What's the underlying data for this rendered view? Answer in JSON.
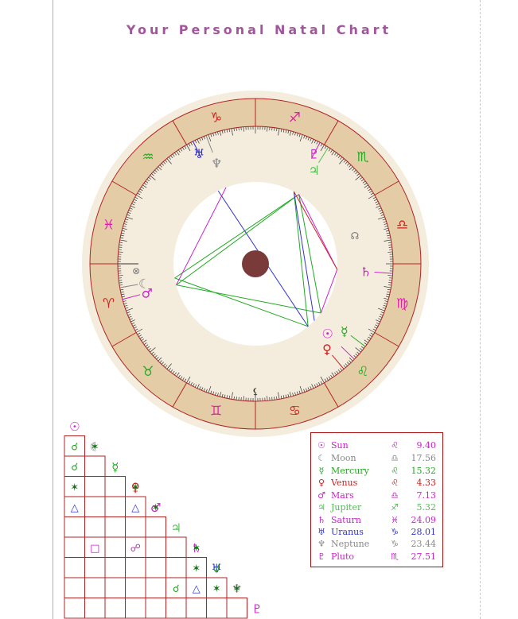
{
  "title": "Your Personal Natal Chart",
  "colors": {
    "frame": "#b22222",
    "cream": "#f4ecdc",
    "tan": "#e4cda6",
    "title": "#a0569a",
    "grey": "#888888"
  },
  "zodiac": [
    {
      "name": "capricorn-sign-icon",
      "glyph": "♑",
      "color": "#cc2222"
    },
    {
      "name": "sagittarius-sign-icon",
      "glyph": "♐",
      "color": "#dd22aa"
    },
    {
      "name": "scorpio-sign-icon",
      "glyph": "♏",
      "color": "#22aa22"
    },
    {
      "name": "libra-sign-icon",
      "glyph": "♎",
      "color": "#cc2222"
    },
    {
      "name": "virgo-sign-icon",
      "glyph": "♍",
      "color": "#dd22aa"
    },
    {
      "name": "leo-sign-icon",
      "glyph": "♌",
      "color": "#22aa22"
    },
    {
      "name": "cancer-sign-icon",
      "glyph": "♋",
      "color": "#cc2222"
    },
    {
      "name": "gemini-sign-icon",
      "glyph": "♊",
      "color": "#dd22aa"
    },
    {
      "name": "taurus-sign-icon",
      "glyph": "♉",
      "color": "#22aa22"
    },
    {
      "name": "aries-sign-icon",
      "glyph": "♈",
      "color": "#cc2222"
    },
    {
      "name": "pisces-sign-icon",
      "glyph": "♓",
      "color": "#dd22aa"
    },
    {
      "name": "aquarius-sign-icon",
      "glyph": "♒",
      "color": "#22aa22"
    }
  ],
  "planets": [
    {
      "name": "Sun",
      "glyph": "☉",
      "sign": "♌",
      "degree": "9.40",
      "color": "#cc22cc",
      "pos": 279.4
    },
    {
      "name": "Moon",
      "glyph": "☾",
      "sign": "♎",
      "degree": "17.56",
      "color": "#888888",
      "pos": 197.56
    },
    {
      "name": "Mercury",
      "glyph": "☿",
      "sign": "♌",
      "degree": "15.32",
      "color": "#22aa22",
      "pos": 285.32
    },
    {
      "name": "Venus",
      "glyph": "♀",
      "sign": "♌",
      "degree": "4.33",
      "color": "#cc2222",
      "pos": 274.33
    },
    {
      "name": "Mars",
      "glyph": "♂",
      "sign": "♎",
      "degree": "7.13",
      "color": "#cc22cc",
      "pos": 187.13
    },
    {
      "name": "Jupiter",
      "glyph": "♃",
      "sign": "♐",
      "degree": "5.32",
      "color": "#55bb55",
      "pos": 125.32
    },
    {
      "name": "Saturn",
      "glyph": "♄",
      "sign": "♓",
      "degree": "24.09",
      "color": "#cc22cc",
      "pos": 5.91
    },
    {
      "name": "Uranus",
      "glyph": "♅",
      "sign": "♑",
      "degree": "28.01",
      "color": "#3333cc",
      "pos": 61.99
    },
    {
      "name": "Neptune",
      "glyph": "♆",
      "sign": "♑",
      "degree": "23.44",
      "color": "#888888",
      "pos": 66.56
    },
    {
      "name": "Pluto",
      "glyph": "♇",
      "sign": "♏",
      "degree": "27.51",
      "color": "#cc22cc",
      "pos": 122.49
    }
  ],
  "extra_points": [
    {
      "name": "node-icon",
      "glyph": "☊",
      "color": "#777777",
      "pos": 164
    },
    {
      "name": "part-of-fortune-icon",
      "glyph": "⊗",
      "color": "#777777",
      "pos": 357
    },
    {
      "name": "lilith-icon",
      "glyph": "⚸",
      "color": "#333333",
      "pos": 268
    }
  ],
  "aspects": [
    {
      "a": 4,
      "b": 2,
      "type": "trine",
      "color": "#22aa22"
    },
    {
      "a": 4,
      "b": 5,
      "type": "trine",
      "color": "#22aa22"
    },
    {
      "a": 2,
      "b": 5,
      "type": "trine",
      "color": "#22aa22"
    },
    {
      "a": 1,
      "b": 3,
      "type": "sextile",
      "color": "#22aa22"
    },
    {
      "a": 1,
      "b": 5,
      "type": "sextile",
      "color": "#22aa22"
    },
    {
      "a": 3,
      "b": 9,
      "type": "sextile",
      "color": "#22aa22"
    },
    {
      "a": 0,
      "b": 9,
      "type": "square",
      "color": "#3333cc"
    },
    {
      "a": 3,
      "b": 7,
      "type": "opposition",
      "color": "#3333cc"
    },
    {
      "a": 6,
      "b": 5,
      "type": "square",
      "color": "#cc22cc"
    },
    {
      "a": 6,
      "b": 2,
      "type": "opposition",
      "color": "#cc22cc"
    },
    {
      "a": 4,
      "b": 8,
      "type": "opposition",
      "color": "#cc22cc"
    },
    {
      "a": 9,
      "b": 6,
      "type": "trine",
      "color": "#cc2222"
    }
  ],
  "grid_aspects": [
    {
      "row": 1,
      "col": 0,
      "glyph": "☌",
      "color": "#22aa22"
    },
    {
      "row": 1,
      "col": 1,
      "glyph": "✶",
      "color": "#117711"
    },
    {
      "row": 2,
      "col": 0,
      "glyph": "☌",
      "color": "#22aa22"
    },
    {
      "row": 3,
      "col": 0,
      "glyph": "✶",
      "color": "#117711"
    },
    {
      "row": 3,
      "col": 3,
      "glyph": "✶",
      "color": "#117711"
    },
    {
      "row": 4,
      "col": 0,
      "glyph": "△",
      "color": "#3333cc"
    },
    {
      "row": 4,
      "col": 3,
      "glyph": "△",
      "color": "#3333cc"
    },
    {
      "row": 4,
      "col": 4,
      "glyph": "✶",
      "color": "#117711"
    },
    {
      "row": 6,
      "col": 1,
      "glyph": "□",
      "color": "#cc22cc"
    },
    {
      "row": 6,
      "col": 3,
      "glyph": "☍",
      "color": "#cc22cc"
    },
    {
      "row": 6,
      "col": 6,
      "glyph": "✶",
      "color": "#117711"
    },
    {
      "row": 7,
      "col": 6,
      "glyph": "✶",
      "color": "#117711"
    },
    {
      "row": 7,
      "col": 7,
      "glyph": "☌",
      "color": "#22aa22"
    },
    {
      "row": 8,
      "col": 5,
      "glyph": "☌",
      "color": "#22aa22"
    },
    {
      "row": 8,
      "col": 6,
      "glyph": "△",
      "color": "#3333cc"
    },
    {
      "row": 8,
      "col": 7,
      "glyph": "✶",
      "color": "#117711"
    },
    {
      "row": 8,
      "col": 8,
      "glyph": "✶",
      "color": "#117711"
    },
    {
      "row": 10,
      "col": 6,
      "glyph": "□",
      "color": "#cc22cc"
    }
  ]
}
